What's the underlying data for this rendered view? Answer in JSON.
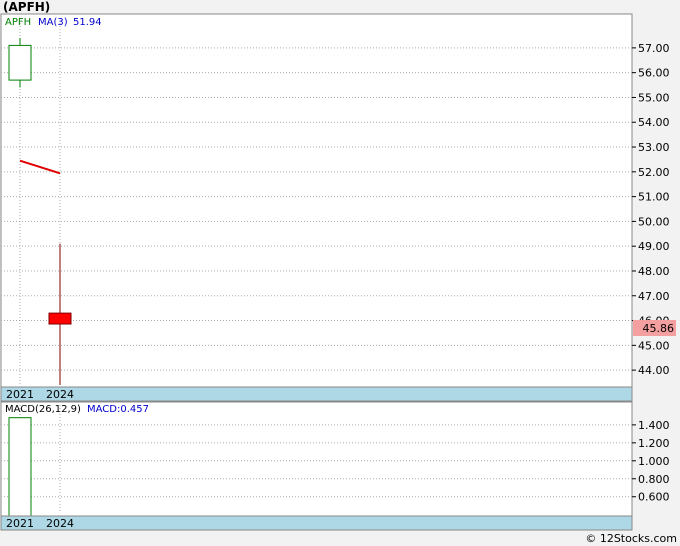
{
  "title": "(APFH)",
  "credit": "© 12Stocks.com",
  "colors": {
    "up": "#008000",
    "down": "#ff0000",
    "ma": "#e00000",
    "macd_label": "#0000cc",
    "axis_band": "#aed8e6",
    "price_tag": "#f4a0a0"
  },
  "chart_data": [
    {
      "type": "candlestick",
      "panel": "price",
      "legend": {
        "symbol": "APFH",
        "ma_label": "MA(3)",
        "ma_value": "51.94"
      },
      "x_ticks": [
        "2021",
        "2024"
      ],
      "ylim": [
        43.4,
        57.6
      ],
      "y_ticks": [
        "57.00",
        "56.00",
        "55.00",
        "54.00",
        "53.00",
        "52.00",
        "51.00",
        "50.00",
        "49.00",
        "48.00",
        "47.00",
        "46.00",
        "45.00",
        "44.00"
      ],
      "candles": [
        {
          "x": "2021",
          "open": 55.7,
          "close": 57.1,
          "high": 57.4,
          "low": 55.4
        },
        {
          "x": "2024",
          "open": 46.3,
          "close": 45.86,
          "high": 49.1,
          "low": 43.4
        }
      ],
      "ma": [
        {
          "x": "2021",
          "value": 52.45
        },
        {
          "x": "2024",
          "value": 51.94
        }
      ],
      "last_price": "45.86"
    },
    {
      "type": "bar",
      "panel": "macd",
      "legend": {
        "label": "MACD(26,12,9)",
        "value_label": "MACD:0.457"
      },
      "x_ticks": [
        "2021",
        "2024"
      ],
      "ylim": [
        0.43,
        1.51
      ],
      "y_ticks": [
        "1.400",
        "1.200",
        "1.000",
        "0.800",
        "0.600"
      ],
      "bars": [
        {
          "x": "2021",
          "value": 1.48
        }
      ]
    }
  ]
}
